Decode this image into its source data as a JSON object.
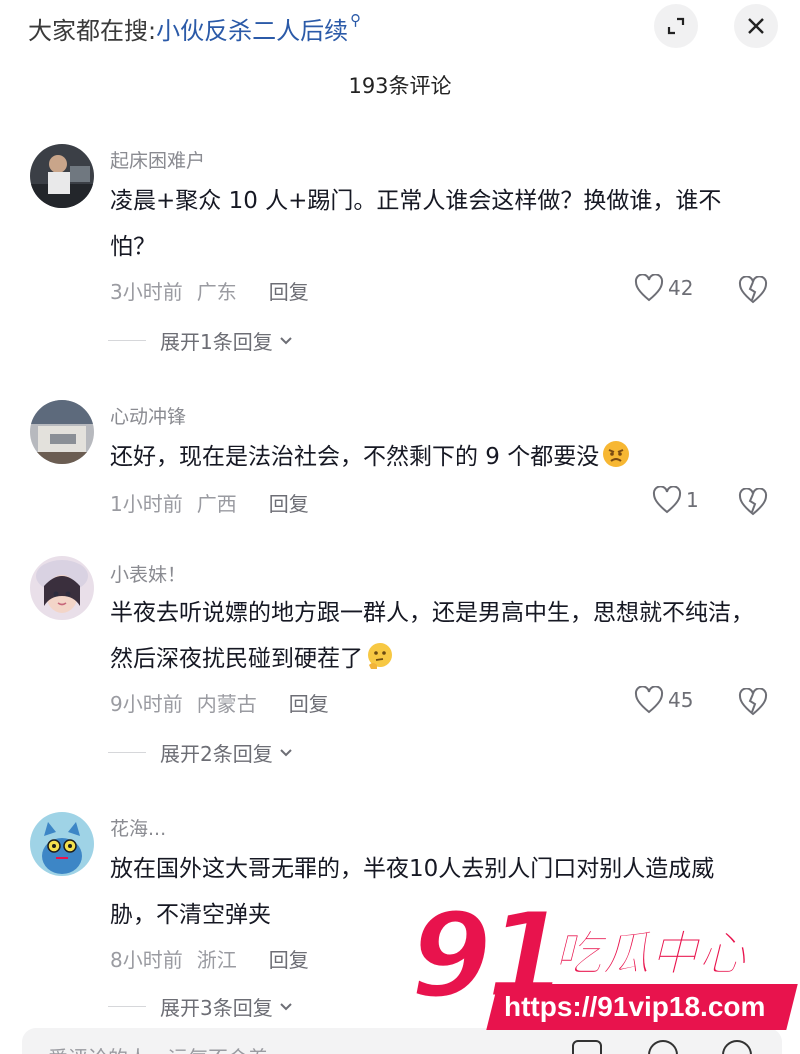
{
  "search": {
    "prefix": "大家都在搜:",
    "term": "小伙反杀二人后续"
  },
  "header": {
    "comment_count": "193条评论"
  },
  "comments": [
    {
      "username": "起床困难户",
      "text": "凌晨+聚众 10 人+踢门。正常人谁会这样做？换做谁，谁不怕？",
      "time": "3小时前",
      "location": "广东",
      "reply_label": "回复",
      "likes": "42",
      "expand_label": "展开1条回复"
    },
    {
      "username": "心动冲锋",
      "text": "还好，现在是法治社会，不然剩下的 9 个都要没",
      "emoji": "angry-face-emoji",
      "time": "1小时前",
      "location": "广西",
      "reply_label": "回复",
      "likes": "1"
    },
    {
      "username": "小表妹！",
      "text": "半夜去听说嫖的地方跟一群人，还是男高中生，思想就不纯洁，然后深夜扰民碰到硬茬了",
      "emoji": "thinking-face-emoji",
      "time": "9小时前",
      "location": "内蒙古",
      "reply_label": "回复",
      "likes": "45",
      "expand_label": "展开2条回复"
    },
    {
      "username": "花海...",
      "text": "放在国外这大哥无罪的，半夜10人去别人门口对别人造成威胁，不清空弹夹",
      "time": "8小时前",
      "location": "浙江",
      "reply_label": "回复",
      "expand_label": "展开3条回复"
    }
  ],
  "watermark": {
    "number": "91",
    "name": "吃瓜中心",
    "url": "https://91vip18.com"
  },
  "input": {
    "placeholder": "爱评论的人，运气不会差"
  },
  "colors": {
    "accent_link": "#2b5aa8",
    "watermark": "#e8134d"
  }
}
